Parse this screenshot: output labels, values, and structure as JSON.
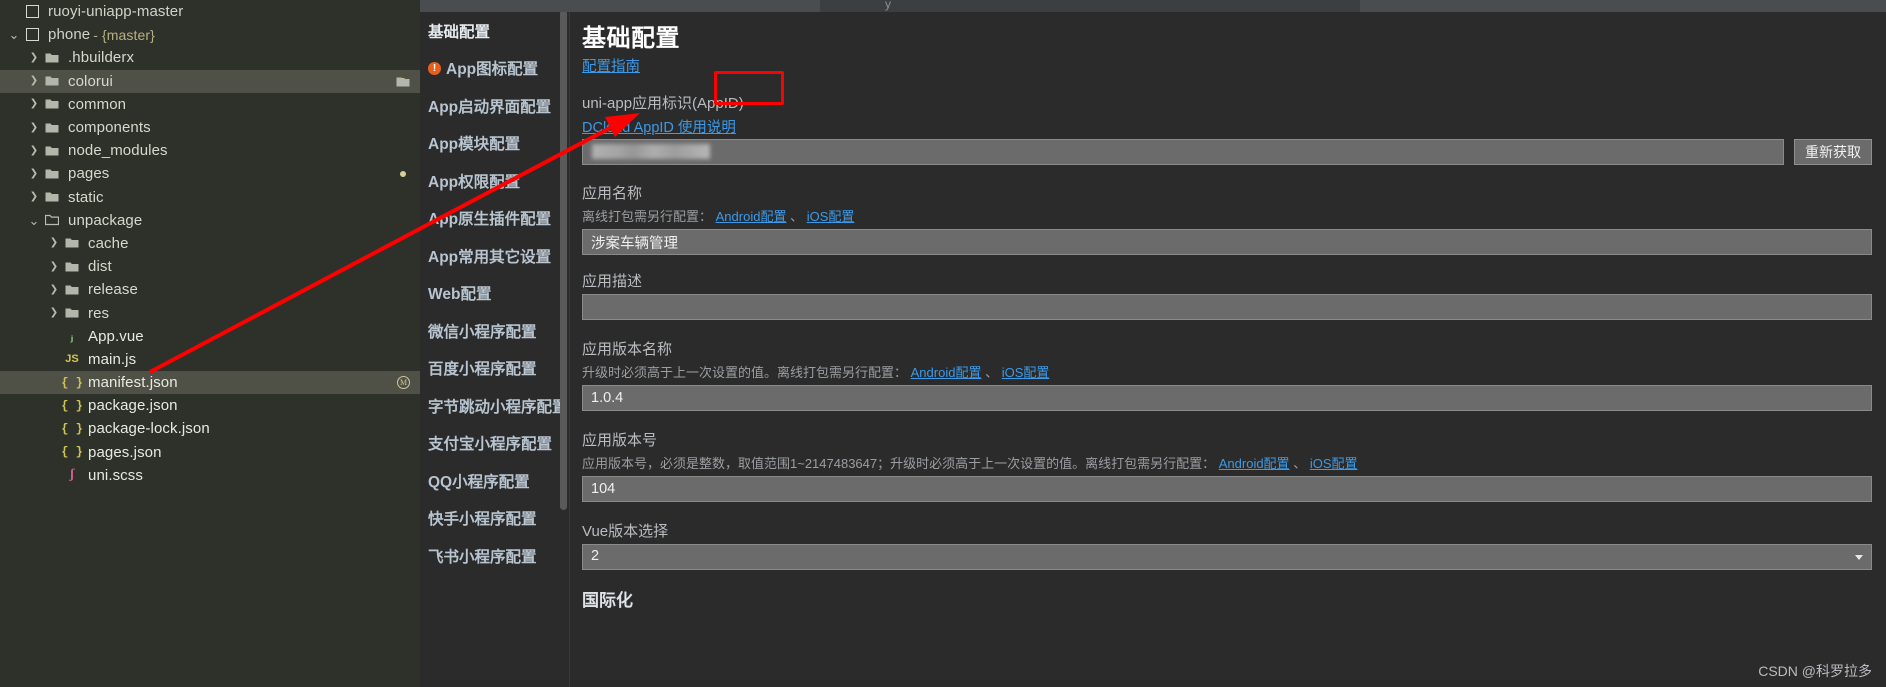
{
  "explorer": {
    "projects": [
      {
        "label": "ruoyi-uniapp-master",
        "type": "project",
        "indent": 0,
        "chevron": "",
        "icon": "hbuilder-project-icon"
      },
      {
        "label": "phone",
        "suffix": " - {master}",
        "type": "project",
        "indent": 0,
        "chevron": "v",
        "icon": "hbuilder-project-icon"
      }
    ],
    "items": [
      {
        "label": ".hbuilderx",
        "type": "folder",
        "indent": 1,
        "chevron": ">",
        "icon": "folder-icon",
        "selected": false,
        "modified": false
      },
      {
        "label": "colorui",
        "type": "folder",
        "indent": 1,
        "chevron": ">",
        "icon": "folder-icon",
        "selected": true,
        "modified": true,
        "openFolder": true
      },
      {
        "label": "common",
        "type": "folder",
        "indent": 1,
        "chevron": ">",
        "icon": "folder-icon",
        "selected": false,
        "modified": false
      },
      {
        "label": "components",
        "type": "folder",
        "indent": 1,
        "chevron": ">",
        "icon": "folder-icon",
        "selected": false,
        "modified": false
      },
      {
        "label": "node_modules",
        "type": "folder",
        "indent": 1,
        "chevron": ">",
        "icon": "folder-icon",
        "selected": false,
        "modified": false
      },
      {
        "label": "pages",
        "type": "folder",
        "indent": 1,
        "chevron": ">",
        "icon": "folder-icon",
        "selected": false,
        "modified": true
      },
      {
        "label": "static",
        "type": "folder",
        "indent": 1,
        "chevron": ">",
        "icon": "folder-icon",
        "selected": false,
        "modified": false
      },
      {
        "label": "unpackage",
        "type": "folder",
        "indent": 1,
        "chevron": "v",
        "icon": "folder-open-icon",
        "selected": false,
        "modified": false
      },
      {
        "label": "cache",
        "type": "folder",
        "indent": 2,
        "chevron": ">",
        "icon": "folder-icon",
        "selected": false,
        "modified": false
      },
      {
        "label": "dist",
        "type": "folder",
        "indent": 2,
        "chevron": ">",
        "icon": "folder-icon",
        "selected": false,
        "modified": false
      },
      {
        "label": "release",
        "type": "folder",
        "indent": 2,
        "chevron": ">",
        "icon": "folder-icon",
        "selected": false,
        "modified": false
      },
      {
        "label": "res",
        "type": "folder",
        "indent": 2,
        "chevron": ">",
        "icon": "folder-icon",
        "selected": false,
        "modified": false
      },
      {
        "label": "App.vue",
        "type": "file",
        "indent": 2,
        "chevron": "",
        "icon": "vue-file-icon",
        "selected": false,
        "modified": false
      },
      {
        "label": "main.js",
        "type": "file",
        "indent": 2,
        "chevron": "",
        "icon": "js-file-icon",
        "selected": false,
        "modified": false
      },
      {
        "label": "manifest.json",
        "type": "file",
        "indent": 2,
        "chevron": "",
        "icon": "json-file-icon",
        "selected": true,
        "modified": false,
        "badge": "M"
      },
      {
        "label": "package.json",
        "type": "file",
        "indent": 2,
        "chevron": "",
        "icon": "json-file-icon",
        "selected": false,
        "modified": false
      },
      {
        "label": "package-lock.json",
        "type": "file",
        "indent": 2,
        "chevron": "",
        "icon": "json-file-icon",
        "selected": false,
        "modified": false
      },
      {
        "label": "pages.json",
        "type": "file",
        "indent": 2,
        "chevron": "",
        "icon": "json-file-icon",
        "selected": false,
        "modified": false
      },
      {
        "label": "uni.scss",
        "type": "file",
        "indent": 2,
        "chevron": "",
        "icon": "scss-file-icon",
        "selected": false,
        "modified": false
      }
    ]
  },
  "nav": {
    "items": [
      {
        "label": "基础配置",
        "active": true,
        "warning": false
      },
      {
        "label": "App图标配置",
        "active": false,
        "warning": true
      },
      {
        "label": "App启动界面配置",
        "active": false,
        "warning": false
      },
      {
        "label": "App模块配置",
        "active": false,
        "warning": false
      },
      {
        "label": "App权限配置",
        "active": false,
        "warning": false
      },
      {
        "label": "App原生插件配置",
        "active": false,
        "warning": false
      },
      {
        "label": "App常用其它设置",
        "active": false,
        "warning": false
      },
      {
        "label": "Web配置",
        "active": false,
        "warning": false
      },
      {
        "label": "微信小程序配置",
        "active": false,
        "warning": false
      },
      {
        "label": "百度小程序配置",
        "active": false,
        "warning": false
      },
      {
        "label": "字节跳动小程序配置",
        "active": false,
        "warning": false
      },
      {
        "label": "支付宝小程序配置",
        "active": false,
        "warning": false
      },
      {
        "label": "QQ小程序配置",
        "active": false,
        "warning": false
      },
      {
        "label": "快手小程序配置",
        "active": false,
        "warning": false
      },
      {
        "label": "飞书小程序配置",
        "active": false,
        "warning": false
      }
    ]
  },
  "content": {
    "title": "基础配置",
    "guide_link": "配置指南",
    "appid": {
      "label": "uni-app应用标识(AppID)",
      "help_link": "DCloud AppID 使用说明",
      "value": "",
      "refetch_button": "重新获取"
    },
    "app_name": {
      "label": "应用名称",
      "hint_prefix": "离线打包需另行配置：",
      "link_android": "Android配置",
      "separator": "、",
      "link_ios": "iOS配置",
      "value": "涉案车辆管理"
    },
    "app_desc": {
      "label": "应用描述",
      "value": ""
    },
    "version_name": {
      "label": "应用版本名称",
      "hint_prefix": "升级时必须高于上一次设置的值。离线打包需另行配置：",
      "link_android": "Android配置",
      "separator": "、",
      "link_ios": "iOS配置",
      "value": "1.0.4"
    },
    "version_code": {
      "label": "应用版本号",
      "hint_prefix": "应用版本号，必须是整数，取值范围1~2147483647；升级时必须高于上一次设置的值。离线打包需另行配置：",
      "link_android": "Android配置",
      "separator": "、",
      "link_ios": "iOS配置",
      "value": "104"
    },
    "vue_version": {
      "label": "Vue版本选择",
      "value": "2"
    },
    "i18n_section": "国际化"
  },
  "watermark": "CSDN @科罗拉多",
  "colors": {
    "accent_link": "#3c9ae8",
    "annotation": "#ff0000",
    "warning": "#e8611c",
    "explorer_bg": "#2e3129",
    "content_bg": "#2b2b2b",
    "input_bg": "#6b6b6b"
  }
}
